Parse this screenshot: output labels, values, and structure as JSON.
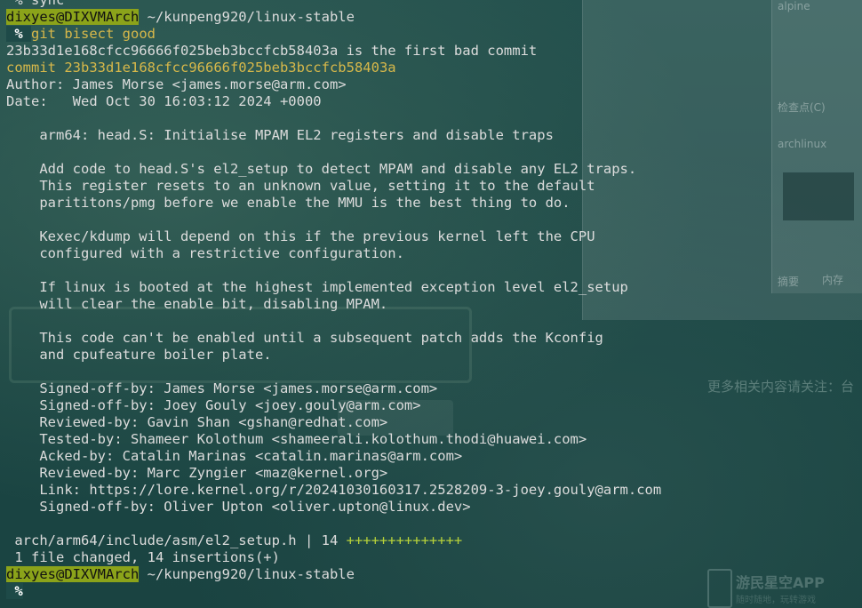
{
  "terminal": {
    "first_line": " % sync",
    "prompt1": {
      "user_host": "dixyes@DIXVMArch",
      "path": " ~/kunpeng920/linux-stable"
    },
    "command_line": {
      "pct": " % ",
      "command": "git bisect good"
    },
    "bisect_result": "23b33d1e168cfcc96666f025beb3bccfcb58403a is the first bad commit",
    "commit": {
      "label": "commit",
      "hash": "23b33d1e168cfcc96666f025beb3bccfcb58403a"
    },
    "author": "Author: James Morse <james.morse@arm.com>",
    "date": "Date:   Wed Oct 30 16:03:12 2024 +0000",
    "message": [
      "",
      "    arm64: head.S: Initialise MPAM EL2 registers and disable traps",
      "",
      "    Add code to head.S's el2_setup to detect MPAM and disable any EL2 traps.",
      "    This register resets to an unknown value, setting it to the default",
      "    parititons/pmg before we enable the MMU is the best thing to do.",
      "",
      "    Kexec/kdump will depend on this if the previous kernel left the CPU",
      "    configured with a restrictive configuration.",
      "",
      "    If linux is booted at the highest implemented exception level el2_setup",
      "    will clear the enable bit, disabling MPAM.",
      "",
      "    This code can't be enabled until a subsequent patch adds the Kconfig",
      "    and cpufeature boiler plate.",
      "",
      "    Signed-off-by: James Morse <james.morse@arm.com>",
      "    Signed-off-by: Joey Gouly <joey.gouly@arm.com>",
      "    Reviewed-by: Gavin Shan <gshan@redhat.com>",
      "    Tested-by: Shameer Kolothum <shameerali.kolothum.thodi@huawei.com>",
      "    Acked-by: Catalin Marinas <catalin.marinas@arm.com>",
      "    Reviewed-by: Marc Zyngier <maz@kernel.org>",
      "    Link: https://lore.kernel.org/r/20241030160317.2528209-3-joey.gouly@arm.com",
      "    Signed-off-by: Oliver Upton <oliver.upton@linux.dev>",
      ""
    ],
    "diffstat": {
      "file": " arch/arm64/include/asm/el2_setup.h | 14 ",
      "plus": "++++++++++++++"
    },
    "summary": " 1 file changed, 14 insertions(+)",
    "prompt2": {
      "user_host": "dixyes@DIXVMArch",
      "path": " ~/kunpeng920/linux-stable"
    },
    "final_prompt": " %"
  },
  "background": {
    "panel_labels": [
      "alpine",
      "检查点(C)",
      "archlinux",
      "摘要",
      "内存"
    ],
    "faint_text": "更多相关内容请关注：台",
    "app_title": "游民星空APP",
    "app_sub": "随时随地，玩转游戏"
  },
  "colors": {
    "prompt_bg": "#8ba31a",
    "accent_yellow": "#d7b84a",
    "plus_green": "#b8d23a",
    "text": "#dcdcdc",
    "background": "#1e4a48"
  }
}
